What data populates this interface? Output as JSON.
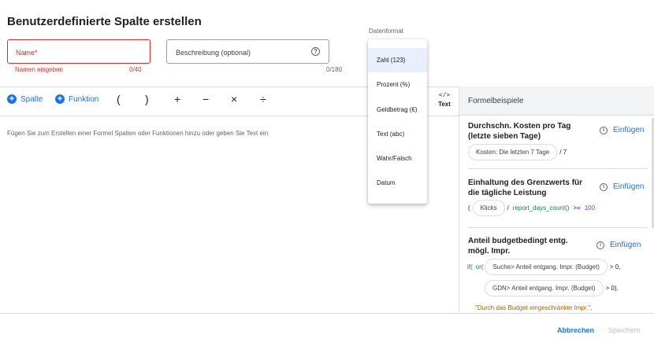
{
  "page": {
    "title": "Benutzerdefinierte Spalte erstellen"
  },
  "name_field": {
    "label": "Name*",
    "error": "Namen eingeben",
    "count": "0/40"
  },
  "description_field": {
    "label": "Beschreibung (optional)",
    "count": "0/180",
    "help_icon": "?"
  },
  "format": {
    "label": "Datenformat",
    "options": [
      "Zahl (123)",
      "Prozent (%)",
      "Geldbetrag (€)",
      "Text (abc)",
      "Wahr/Falsch",
      "Datum"
    ],
    "selected_index": 0
  },
  "toolbar": {
    "column_label": "Spalte",
    "function_label": "Funktion",
    "operators": [
      "(",
      ")",
      "+",
      "−",
      "×",
      "÷"
    ],
    "code_symbol": "</>",
    "text_label": "Text"
  },
  "editor": {
    "placeholder": "Fügen Sie zum Erstellen einer Formel Spalten oder Funktionen hinzu oder geben Sie Text ein"
  },
  "examples_panel": {
    "header": "Formelbeispiele",
    "insert_label": "Einfügen",
    "info_icon": "i",
    "examples": [
      {
        "title": "Durchschn. Kosten pro Tag (letzte sieben Tage)",
        "chip": "Kosten: Die letzten 7 Tage",
        "suffix": "/ 7"
      },
      {
        "title": "Einhaltung des Grenzwerts für die tägliche Leistung",
        "prefix": "(",
        "chip": "Klicks",
        "op": "/",
        "fn": "report_days_count()",
        "cmp": ">=",
        "num": "100"
      },
      {
        "title": "Anteil budgetbedingt entg. mögl. Impr.",
        "fn1": "if(",
        "fn2": "or(",
        "chip1": "Suche> Anteil entgang. Impr. (Budget)",
        "cmp1": "> 0,",
        "chip2": "GDN> Anteil entgang. Impr. (Budget)",
        "cmp2": "> 0),",
        "string": "\"Durch das Budget eingeschränkte Impr.\","
      }
    ]
  },
  "footer": {
    "cancel_label": "Abbrechen",
    "save_label": "Speichern"
  },
  "colors": {
    "accent": "#1a73e8",
    "error": "#d93025",
    "function": "#188038",
    "number": "#9334e6",
    "string": "#b06000"
  }
}
